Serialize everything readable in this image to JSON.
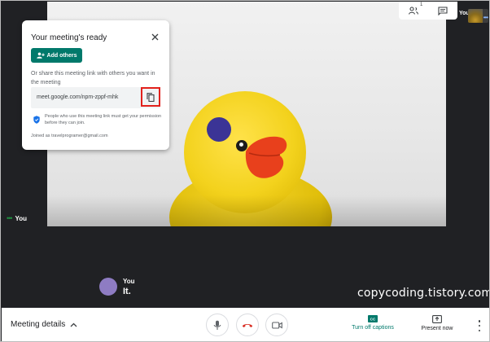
{
  "card": {
    "title": "Your meeting's ready",
    "add_others_label": "Add others",
    "share_text": "Or share this meeting link with others you want in the meeting",
    "meeting_link": "meet.google.com/npm-zppf-mhk",
    "permission_text": "People who use this meeting link must get your permission before they can join.",
    "joined_as": "Joined as travelprogramer@gmail.com",
    "close_icon": "close-icon",
    "copy_icon": "copy-icon",
    "shield_icon": "shield-icon",
    "highlight_color": "#e2211c"
  },
  "top_controls": {
    "people_count": "1",
    "people_icon": "people-icon",
    "chat_icon": "chat-icon"
  },
  "self_view": {
    "label_top": "You",
    "label_left": "You"
  },
  "caption": {
    "speaker": "You",
    "text": "It."
  },
  "watermark": "copycoding.tistory.com",
  "bottom_bar": {
    "meeting_details_label": "Meeting details",
    "captions_label": "Turn off captions",
    "captions_badge": "CC",
    "present_label": "Present now"
  },
  "colors": {
    "accent_teal": "#00796b",
    "hangup_red": "#d93025",
    "stage_bg": "#202124"
  }
}
